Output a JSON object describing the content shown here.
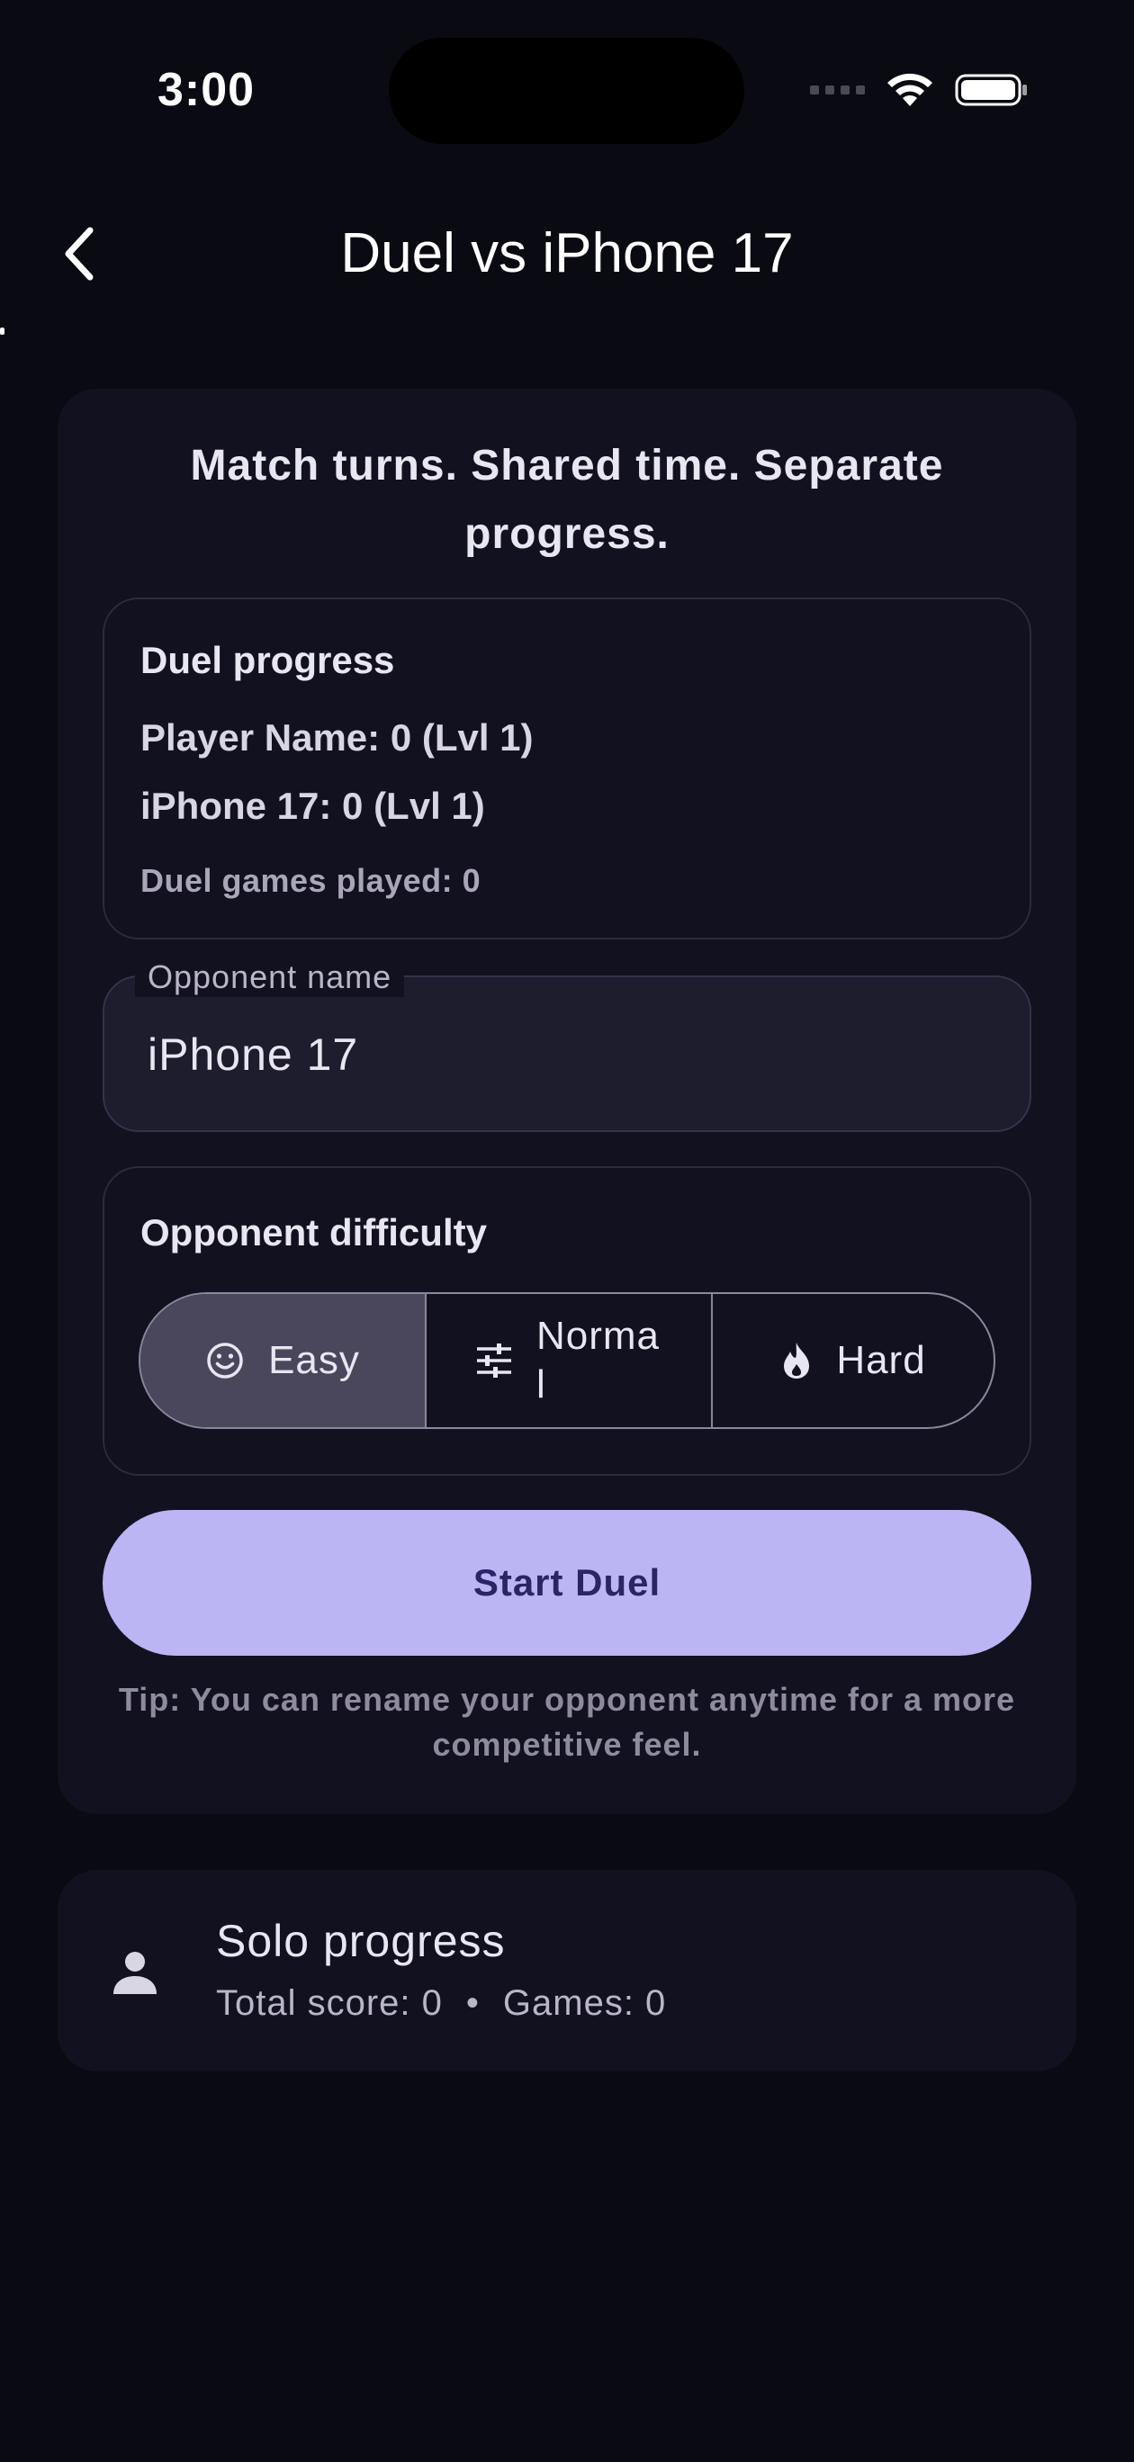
{
  "status_bar": {
    "time": "3:00"
  },
  "header": {
    "title": "Duel vs iPhone 17",
    "back_icon": "chevron-left-icon"
  },
  "main_card": {
    "headline": "Match turns. Shared time. Separate progress.",
    "duel_progress": {
      "heading": "Duel progress",
      "player_line": "Player Name: 0 (Lvl 1)",
      "opponent_line": "iPhone 17: 0 (Lvl 1)",
      "games_played": "Duel games played: 0"
    },
    "opponent_name": {
      "label": "Opponent name",
      "value": "iPhone 17"
    },
    "difficulty": {
      "heading": "Opponent difficulty",
      "options": [
        {
          "label": "Easy",
          "icon": "smiley-icon",
          "selected": true
        },
        {
          "label": "Normal",
          "icon": "tune-icon",
          "selected": false
        },
        {
          "label": "Hard",
          "icon": "flame-icon",
          "selected": false
        }
      ]
    },
    "start_button": "Start Duel",
    "tip": "Tip: You can rename your opponent anytime for a more competitive feel."
  },
  "solo": {
    "icon": "person-icon",
    "title": "Solo progress",
    "total_score": "Total score: 0",
    "separator": "•",
    "games": "Games: 0"
  },
  "colors": {
    "background": "#0a0a12",
    "card": "#12111f",
    "accent": "#bbb5f3",
    "accent_text": "#2a2566",
    "selected_segment": "#4a475d"
  }
}
